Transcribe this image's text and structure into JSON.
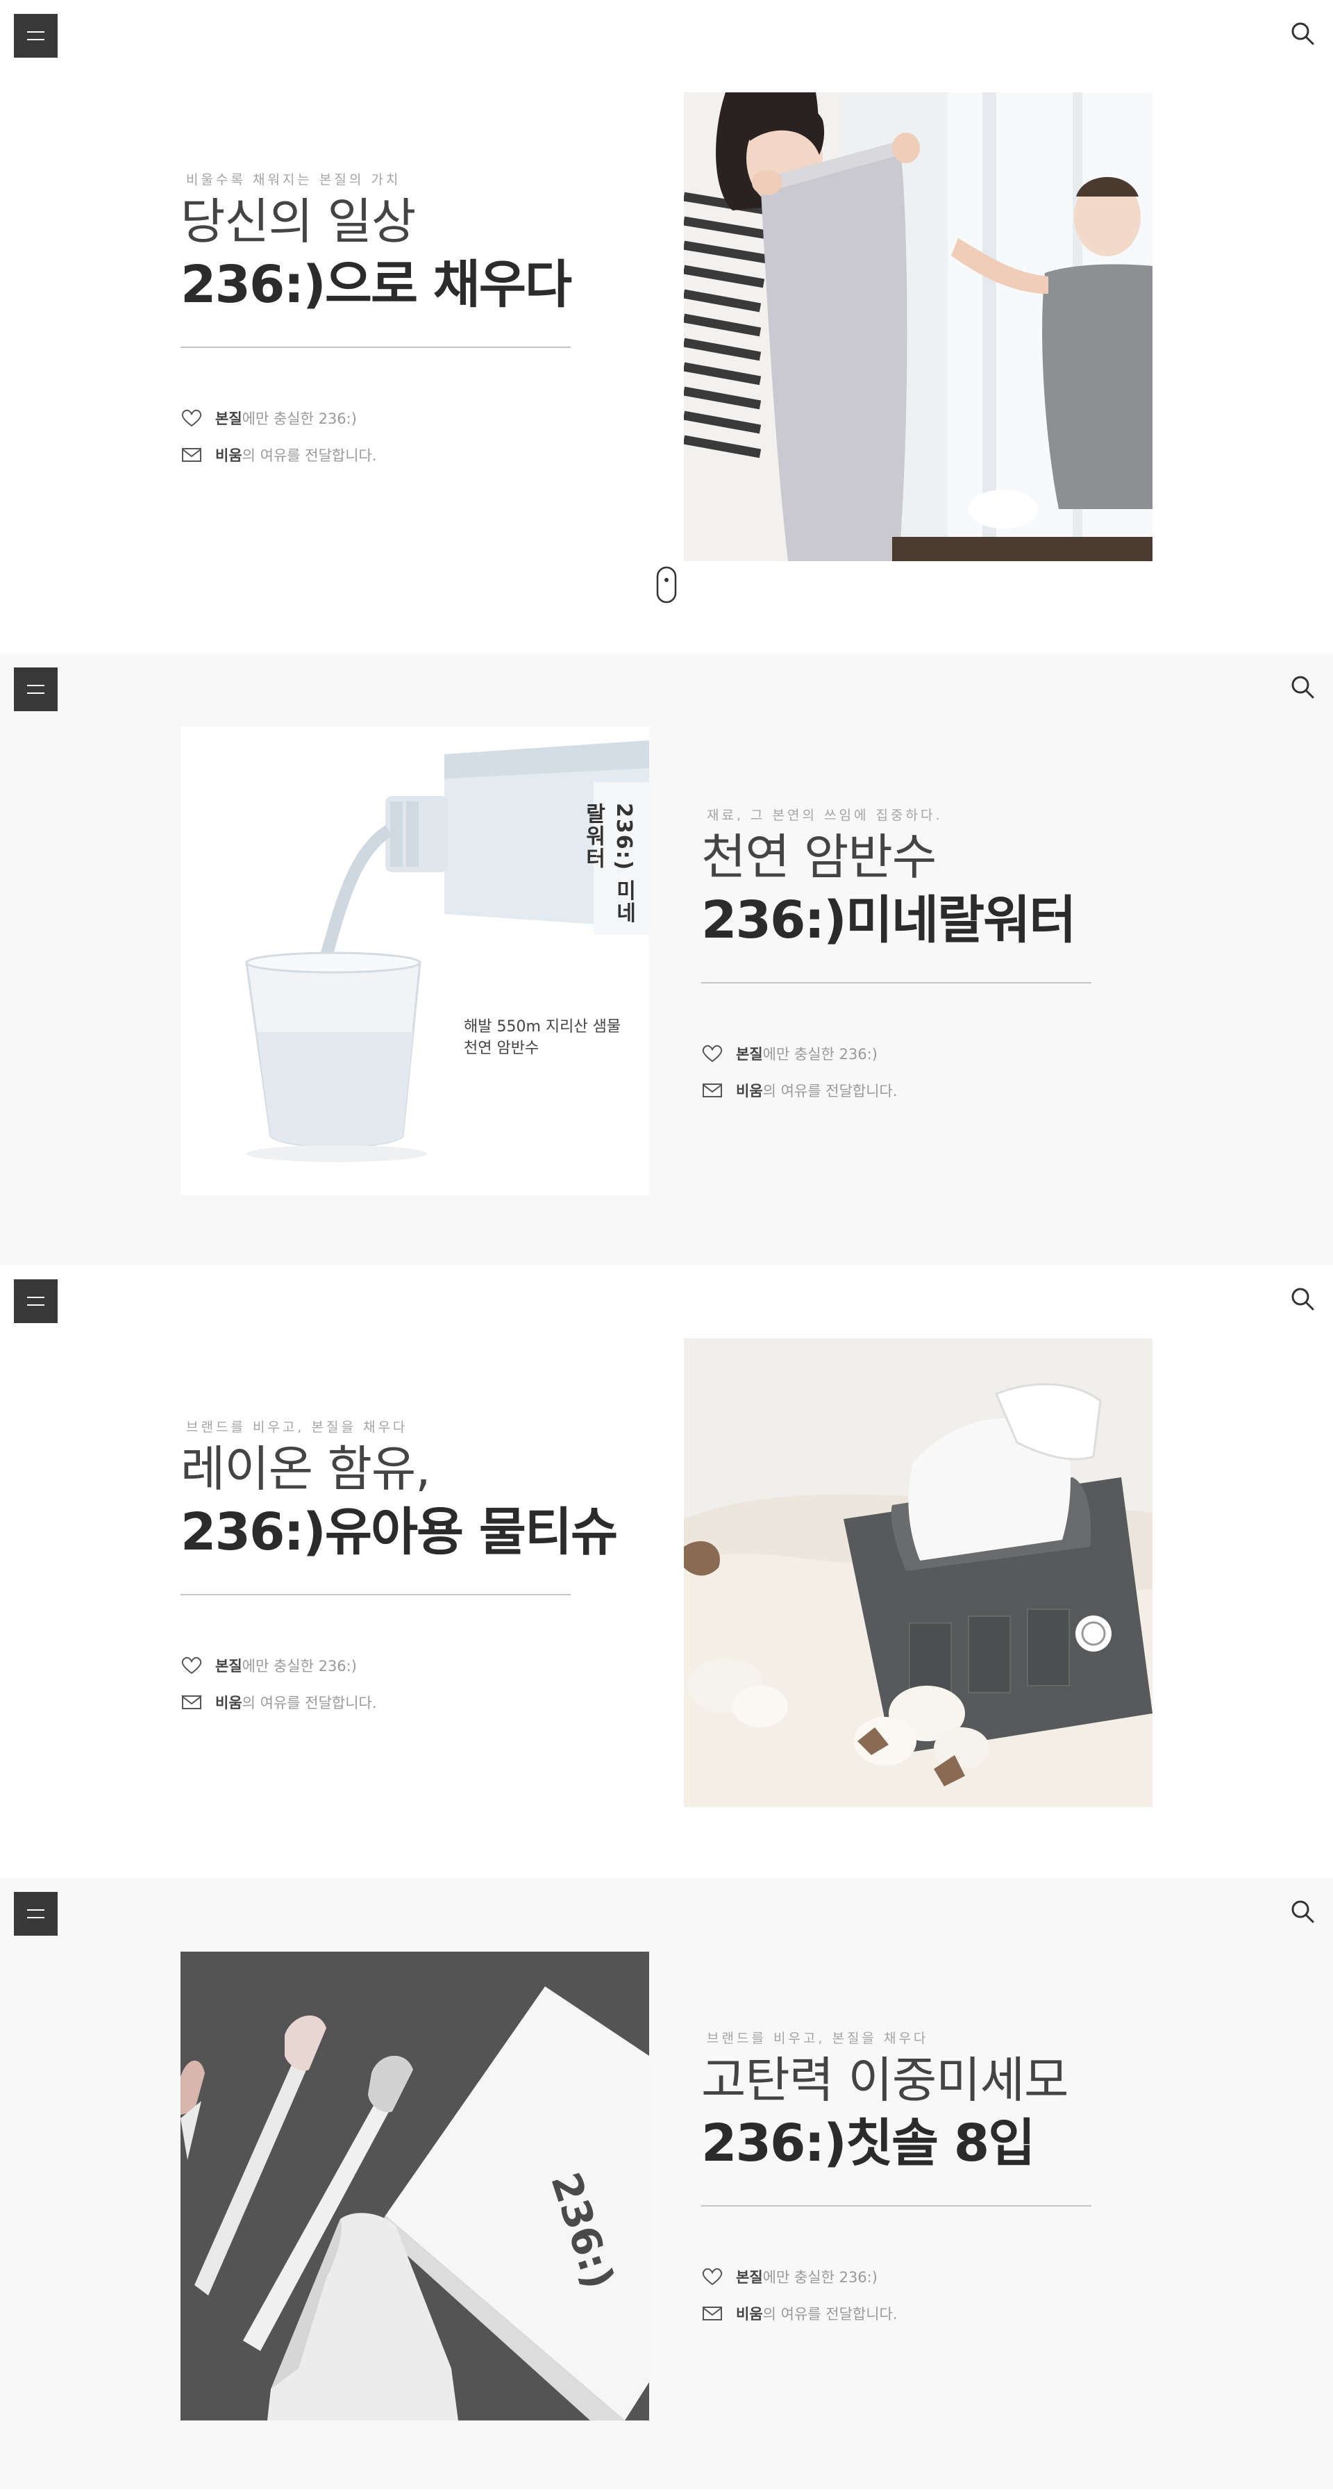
{
  "nav": {
    "menu_icon": "hamburger-menu-icon",
    "search_icon": "search-icon"
  },
  "features": {
    "line1_bold": "본질",
    "line1_rest": "에만 충실한 236:)",
    "line2_bold": "비움",
    "line2_rest": "의 여유를 전달합니다.",
    "icon1": "heart-icon",
    "icon2": "envelope-icon"
  },
  "sections": [
    {
      "eyebrow": "비울수록 채워지는 본질의 가치",
      "headline_light": "당신의 일상",
      "headline_bold": "236:)으로 채우다"
    },
    {
      "eyebrow": "재료, 그 본연의 쓰임에 집중하다.",
      "headline_light": "천연 암반수",
      "headline_bold": "236:)미네랄워터",
      "image_caption_line1": "해발 550m 지리산 샘물",
      "image_caption_line2": "천연 암반수",
      "bottle_label": "236:) 미네랄워터"
    },
    {
      "eyebrow": "브랜드를 비우고, 본질을 채우다",
      "headline_light": "레이온 함유,",
      "headline_bold": "236:)유아용 물티슈"
    },
    {
      "eyebrow": "브랜드를 비우고, 본질을 채우다",
      "headline_light": "고탄력 이중미세모",
      "headline_bold": "236:)칫솔 8입",
      "box_label": "236:)"
    }
  ],
  "scroll_indicator": {
    "icon": "mouse-scroll-icon",
    "arrow_icon": "chevron-down-icon"
  },
  "colors": {
    "nav_bg": "#383838",
    "section_alt_bg": "#f8f8f8",
    "text_dark": "#2b2b2b",
    "text_muted": "#9a9a9a"
  }
}
